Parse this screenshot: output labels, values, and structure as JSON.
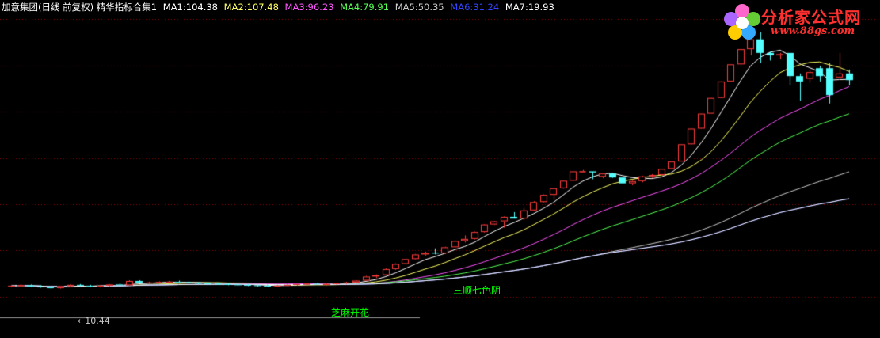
{
  "header": {
    "title": "加意集团(日线 前复权) 精华指标合集1",
    "ma": [
      {
        "label": "MA1:",
        "value": "104.38",
        "color": "#ffffff"
      },
      {
        "label": "MA2:",
        "value": "107.48",
        "color": "#ffff66"
      },
      {
        "label": "MA3:",
        "value": "96.23",
        "color": "#ff55ff"
      },
      {
        "label": "MA4:",
        "value": "79.91",
        "color": "#55ff55"
      },
      {
        "label": "MA5:",
        "value": "50.35",
        "color": "#cccccc"
      },
      {
        "label": "MA6:",
        "value": "31.24",
        "color": "#3344ff"
      },
      {
        "label": "MA7:",
        "value": "19.93",
        "color": "#ffffff"
      }
    ]
  },
  "logo": {
    "name": "分析家公式网",
    "url": "www.88gs.com"
  },
  "annotations": {
    "top": "三顺七色阴",
    "bottom": "芝麻开花",
    "low_label": "←10.44"
  },
  "colors": {
    "up": "#ff3c3c",
    "down": "#54ffff",
    "grid": "#8b0000"
  },
  "chart_data": {
    "type": "candlestick",
    "y_range": [
      5,
      160
    ],
    "candles": [
      [
        11,
        11.4,
        10.8,
        11.2
      ],
      [
        11.2,
        11.6,
        11,
        11.3
      ],
      [
        11.3,
        11.5,
        10.9,
        11
      ],
      [
        11,
        11.3,
        10.7,
        10.9
      ],
      [
        10.9,
        11.1,
        10.44,
        10.6
      ],
      [
        10.6,
        11.2,
        10.5,
        11.1
      ],
      [
        11.1,
        11.5,
        10.9,
        11.4
      ],
      [
        11.4,
        11.6,
        11.1,
        11.2
      ],
      [
        11.2,
        11.4,
        10.9,
        11
      ],
      [
        11,
        11.3,
        10.8,
        11.2
      ],
      [
        11.2,
        11.6,
        11,
        11.5
      ],
      [
        11.5,
        11.8,
        11.2,
        11.3
      ],
      [
        11.3,
        12.6,
        11.2,
        12.4
      ],
      [
        12.4,
        12.6,
        11.8,
        11.9
      ],
      [
        11.9,
        12.2,
        11.6,
        12
      ],
      [
        12,
        12.3,
        11.8,
        12.1
      ],
      [
        12.1,
        12.4,
        11.9,
        12.2
      ],
      [
        12.2,
        12.5,
        12,
        12.1
      ],
      [
        12.1,
        12.3,
        11.8,
        11.9
      ],
      [
        11.9,
        12.1,
        11.6,
        11.8
      ],
      [
        11.8,
        12,
        11.5,
        11.7
      ],
      [
        11.7,
        11.9,
        11.4,
        11.6
      ],
      [
        11.6,
        11.8,
        11.3,
        11.5
      ],
      [
        11.5,
        11.7,
        11.2,
        11.4
      ],
      [
        11.4,
        11.6,
        11.1,
        11.3
      ],
      [
        11.3,
        11.5,
        11,
        11.2
      ],
      [
        11.2,
        11.4,
        10.9,
        11.1
      ],
      [
        11.1,
        11.3,
        10.9,
        11.2
      ],
      [
        11.2,
        11.5,
        11,
        11.4
      ],
      [
        11.4,
        11.7,
        11.2,
        11.6
      ],
      [
        11.6,
        11.9,
        11.4,
        11.7
      ],
      [
        11.7,
        11.9,
        11.4,
        11.5
      ],
      [
        11.5,
        11.8,
        11.3,
        11.6
      ],
      [
        11.6,
        11.9,
        11.4,
        11.8
      ],
      [
        11.8,
        12.2,
        11.6,
        12
      ],
      [
        12,
        12.6,
        11.9,
        12.5
      ],
      [
        12.5,
        13.8,
        12.4,
        13.6
      ],
      [
        13.6,
        14.2,
        13.2,
        14
      ],
      [
        14,
        16,
        13.9,
        15.8
      ],
      [
        15.8,
        17.6,
        15.6,
        17.4
      ],
      [
        17.4,
        19.2,
        17.2,
        19
      ],
      [
        19,
        20.8,
        18.9,
        20.6
      ],
      [
        20.6,
        21.6,
        20.2,
        21.2
      ],
      [
        21.2,
        22.8,
        20.6,
        21
      ],
      [
        21,
        23.4,
        20.8,
        23.2
      ],
      [
        23.2,
        25.8,
        23,
        25.6
      ],
      [
        25.6,
        27.8,
        25,
        26.4
      ],
      [
        26.4,
        29.4,
        26.2,
        29.2
      ],
      [
        29.2,
        32.6,
        29,
        32.4
      ],
      [
        32.4,
        34,
        32.2,
        33.8
      ],
      [
        33.8,
        36,
        31,
        35.8
      ],
      [
        35.8,
        38,
        35,
        35
      ],
      [
        35,
        40,
        34.2,
        38.8
      ],
      [
        38.8,
        43.2,
        38.4,
        42.8
      ],
      [
        42.8,
        46.6,
        42.6,
        46.4
      ],
      [
        46.4,
        50,
        44,
        49.8
      ],
      [
        49.8,
        54,
        49.6,
        53.8
      ],
      [
        53.8,
        59,
        53.6,
        59
      ],
      [
        59,
        59.8,
        59,
        59
      ],
      [
        59,
        58.8,
        54.6,
        58.4
      ],
      [
        56,
        58,
        55.2,
        57.8
      ],
      [
        57.8,
        57.8,
        55.4,
        55.6
      ],
      [
        55.6,
        56,
        52.4,
        52.4
      ],
      [
        52.4,
        54,
        51.4,
        53.6
      ],
      [
        53.6,
        56.6,
        53,
        56.2
      ],
      [
        56.2,
        57.4,
        55.4,
        57
      ],
      [
        57,
        60.4,
        56.8,
        60.4
      ],
      [
        60.4,
        64.6,
        60.4,
        64.6
      ],
      [
        64.6,
        75,
        64.6,
        75
      ],
      [
        75,
        85,
        75,
        85
      ],
      [
        85,
        95,
        85,
        95
      ],
      [
        95,
        106,
        95,
        106
      ],
      [
        106,
        118,
        106,
        118
      ],
      [
        118,
        131,
        118,
        131
      ],
      [
        131,
        143,
        131,
        143
      ],
      [
        143,
        151,
        138,
        151
      ],
      [
        151,
        157,
        132,
        140
      ],
      [
        140,
        141,
        134,
        138
      ],
      [
        138,
        140,
        135,
        139
      ],
      [
        140,
        135,
        115,
        122
      ],
      [
        122,
        124,
        104,
        118
      ],
      [
        120,
        127,
        117,
        125
      ],
      [
        128,
        130,
        118,
        122
      ],
      [
        128,
        132,
        102,
        108
      ],
      [
        121,
        140,
        119,
        124
      ],
      [
        124,
        127,
        115,
        119
      ]
    ]
  }
}
